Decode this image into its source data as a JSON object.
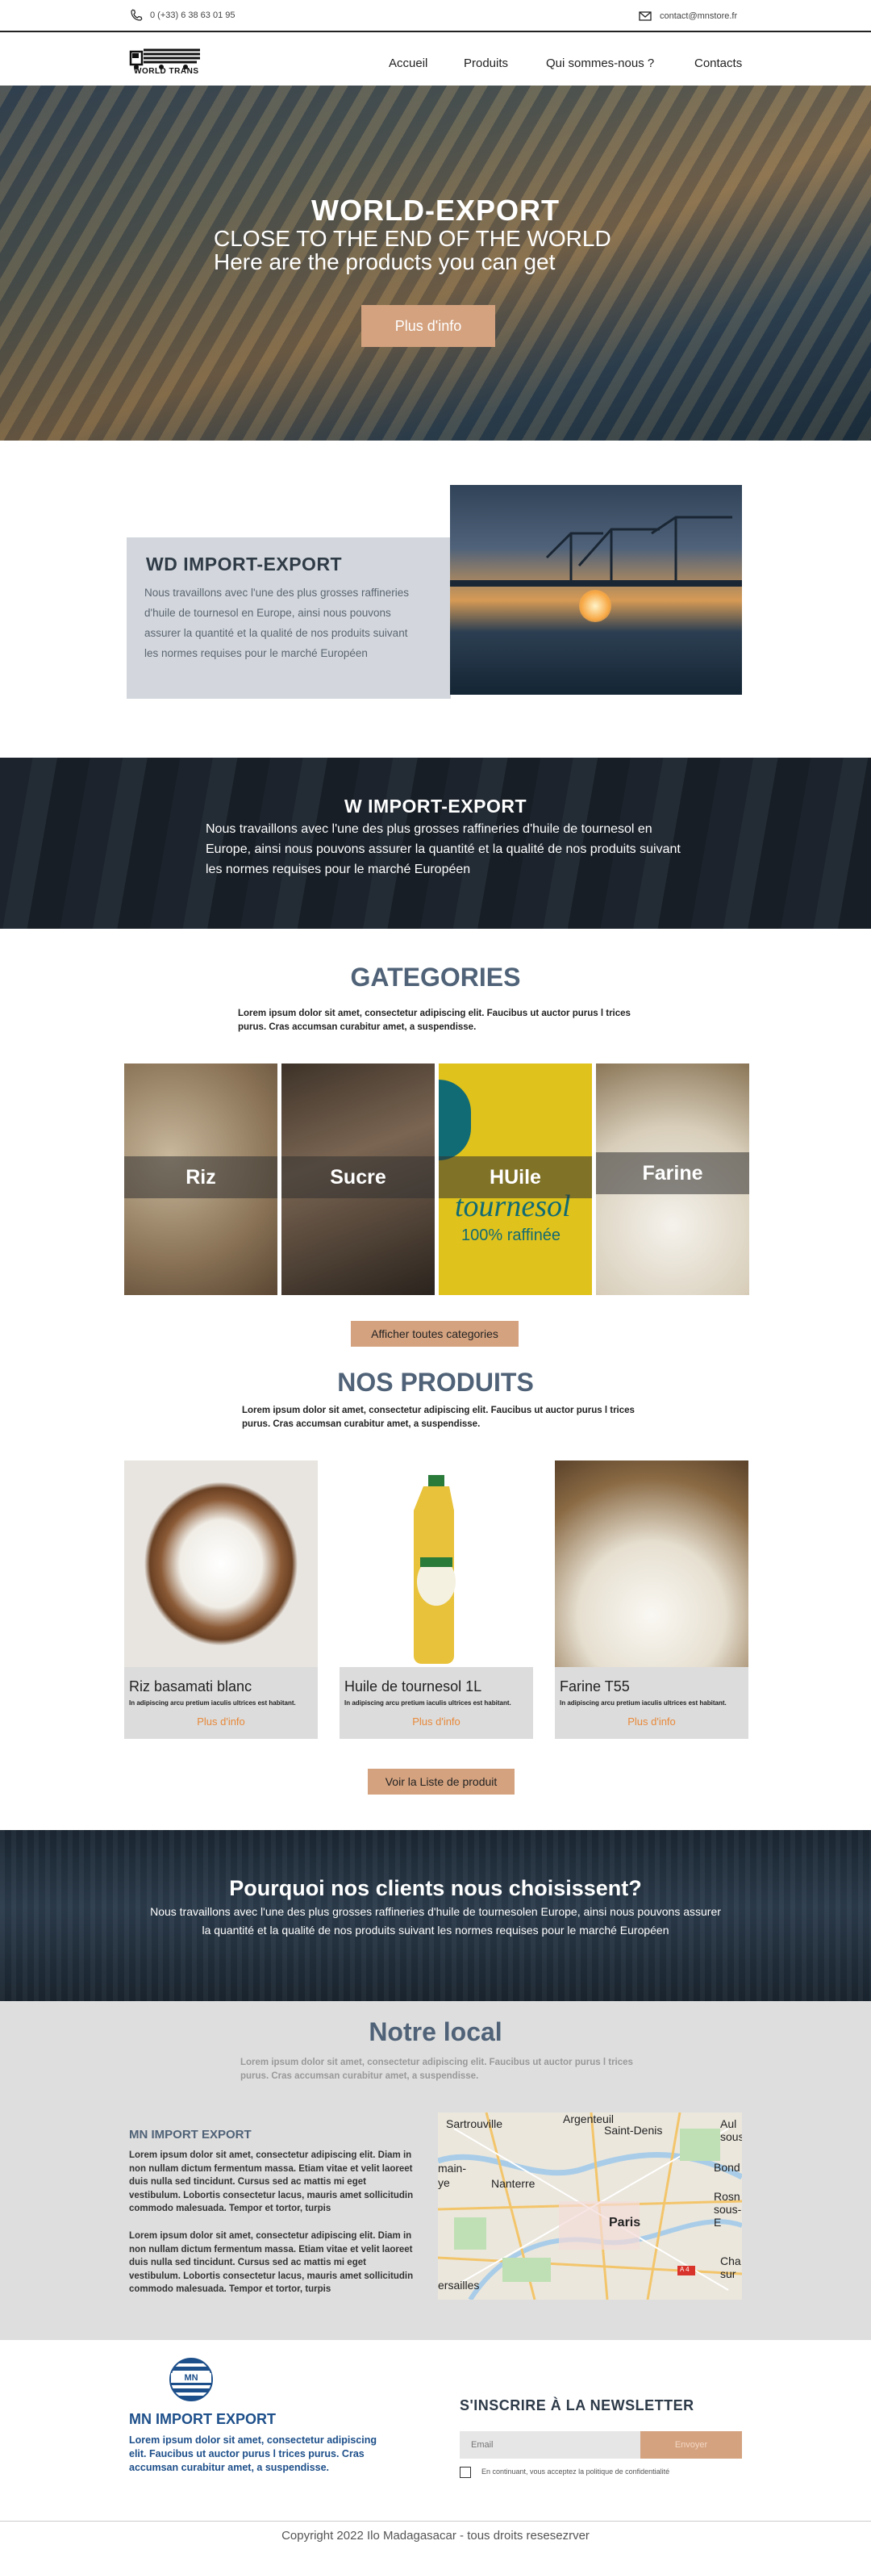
{
  "topbar": {
    "phone": "0 (+33) 6 38 63 01 95",
    "email": "contact@mnstore.fr"
  },
  "brand": {
    "logo_text": "WORLD TRANS"
  },
  "nav": {
    "items": [
      "Accueil",
      "Produits",
      "Qui sommes-nous ?",
      "Contacts"
    ]
  },
  "hero": {
    "title": "WORLD-EXPORT",
    "line1": "CLOSE TO THE END OF THE WORLD",
    "line2": "Here are the products you can get",
    "button": "Plus d'info"
  },
  "about": {
    "title": "WD IMPORT-EXPORT",
    "text": "Nous travaillons avec l'une des plus grosses raffineries  d'huile de tournesol en Europe, ainsi nous pouvons assurer la quantité et la qualité de nos produits suivant les normes requises pour le marché Européen"
  },
  "banner": {
    "title": "W IMPORT-EXPORT",
    "text": "Nous travaillons avec l'une des plus grosses raffineries  d'huile de tournesol en Europe, ainsi nous pouvons assurer la quantité et la qualité de nos produits suivant les normes  requises pour le marché Européen"
  },
  "categories": {
    "title": "GATEGORIES",
    "subtitle": "Lorem ipsum dolor sit amet, consectetur adipiscing elit. Faucibus ut auctor purus l               trices purus. Cras accumsan curabitur amet, a suspendisse.",
    "items": [
      "Riz",
      "Sucre",
      "HUile",
      "Farine"
    ],
    "oil_label_text": "tournesol",
    "oil_label_sub": "100% raffinée",
    "button": "Afficher toutes  categories"
  },
  "products": {
    "title": "NOS PRODUITS",
    "subtitle": "Lorem ipsum dolor sit amet, consectetur adipiscing elit. Faucibus ut auctor purus l               trices purus. Cras accumsan curabitur amet, a suspendisse.",
    "items": [
      {
        "name": "Riz basamati blanc",
        "desc": "In adipiscing arcu pretium iaculis ultrices est habitant.",
        "more": "Plus d'info"
      },
      {
        "name": "Huile de tournesol 1L",
        "desc": "In adipiscing arcu pretium iaculis ultrices est habitant.",
        "more": "Plus d'info"
      },
      {
        "name": "Farine T55",
        "desc": "In adipiscing arcu pretium iaculis ultrices est habitant.",
        "more": "Plus d'info"
      }
    ],
    "button": "Voir  la Liste de produit"
  },
  "why": {
    "title": "Pourquoi nos clients nous choisissent?",
    "text": "Nous travaillons avec l'une des plus grosses raffineries  d'huile de tournesolen Europe, ainsi nous pouvons assurer la quantité et la qualité de nos produits suivant les normes  requises pour le marché Européen"
  },
  "location": {
    "title": "Notre local",
    "subtitle": "Lorem ipsum dolor sit amet, consectetur adipiscing elit. Faucibus ut auctor purus l               trices purus. Cras accumsan curabitur amet, a suspendisse.",
    "heading": "MN IMPORT EXPORT",
    "para1": "Lorem ipsum dolor sit amet, consectetur adipiscing elit. Diam in non nullam dictum fermentum massa. Etiam vitae et velit laoreet duis nulla sed tincidunt. Cursus sed ac mattis mi eget vestibulum. Lobortis consectetur lacus, mauris amet sollicitudin commodo malesuada. Tempor et tortor, turpis",
    "para2": "Lorem ipsum dolor sit amet, consectetur adipiscing elit. Diam in non nullam dictum fermentum massa. Etiam vitae et velit laoreet duis nulla sed tincidunt. Cursus sed ac mattis mi eget vestibulum. Lobortis consectetur lacus, mauris amet sollicitudin commodo malesuada. Tempor et tortor, turpis",
    "map_labels": [
      "Argenteuil",
      "Sartrouville",
      "Saint-Denis",
      "Aul sous",
      "main-ye",
      "Nanterre",
      "Bond",
      "Rosn sous-E",
      "Paris",
      "Cha sur",
      "ersailles",
      "A 4"
    ]
  },
  "footer": {
    "logo_text": "MN",
    "title": "MN IMPORT EXPORT",
    "text": "Lorem ipsum dolor sit amet, consectetur adipiscing elit. Faucibus ut auctor purus                l trices purus. Cras accumsan curabitur amet, a suspendisse.",
    "newsletter_title": "S'INSCRIRE À LA NEWSLETTER",
    "email_placeholder": "Email",
    "submit": "Envoyer",
    "consent": "En continuant, vous acceptez la politique de confidentialité",
    "copyright": "Copyright 2022 Ilo Madagasacar - tous droits resesezrver"
  },
  "colors": {
    "accent": "#d4a27f",
    "heading": "#4f6277",
    "link": "#e8893a",
    "footer_blue": "#1d4f8a"
  }
}
